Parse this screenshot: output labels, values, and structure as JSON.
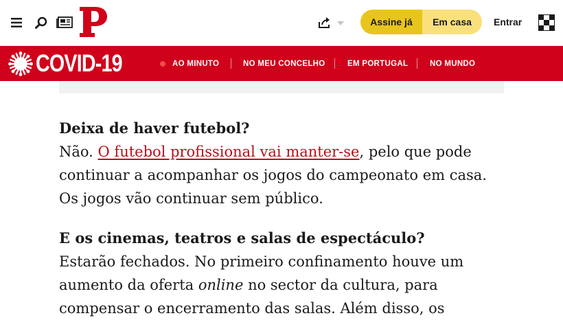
{
  "header": {
    "brand_letter": "P",
    "subscribe_label": "Assine já",
    "home_label": "Em casa",
    "login_label": "Entrar",
    "icons": [
      "menu-icon",
      "search-icon",
      "newspaper-icon",
      "share-icon",
      "chevron-down-icon",
      "puzzle-icon"
    ]
  },
  "covid_bar": {
    "title": "COVID-19",
    "nav": [
      "AO MINUTO",
      "NO MEU CONCELHO",
      "EM PORTUGAL",
      "NO MUNDO"
    ],
    "color": "#d0021b"
  },
  "article": {
    "q1": "Deixa de haver futebol?",
    "a1_prefix": "Não. ",
    "a1_link": "O futebol profissional vai manter-se",
    "a1_line1_rest": ", pelo que pode",
    "a1_line2": "continuar a acompanhar os jogos do campeonato em casa.",
    "a1_line3": "Os jogos vão continuar sem público.",
    "q2": "E os cinemas, teatros e salas de espectáculo?",
    "a2_line1": "Estarão fechados. No primeiro confinamento houve um",
    "a2_line2_pre": "aumento da oferta ",
    "a2_line2_em": "online",
    "a2_line2_post": " no sector da cultura, para",
    "a2_line3": "compensar o encerramento das salas. Além disso, os"
  },
  "colors": {
    "link": "#b7101a",
    "subscribe": "#e8c51d",
    "home": "#f9e07a"
  }
}
